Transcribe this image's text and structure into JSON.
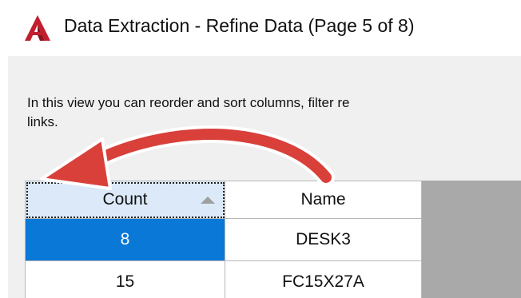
{
  "window": {
    "title": "Data Extraction - Refine Data (Page 5 of 8)",
    "icon": "autocad-logo-icon"
  },
  "instructions": {
    "text": "In this view you can reorder and sort columns, filter re\nlinks."
  },
  "grid": {
    "columns": [
      {
        "label": "Count",
        "sorted": "ascending"
      },
      {
        "label": "Name"
      }
    ],
    "rows": [
      {
        "count": "8",
        "name": "DESK3",
        "selected": true
      },
      {
        "count": "15",
        "name": "FC15X27A"
      }
    ]
  },
  "colors": {
    "accent_red": "#d9403a",
    "selection_blue": "#0a78d7",
    "sorted_header": "#dbe9f8"
  }
}
